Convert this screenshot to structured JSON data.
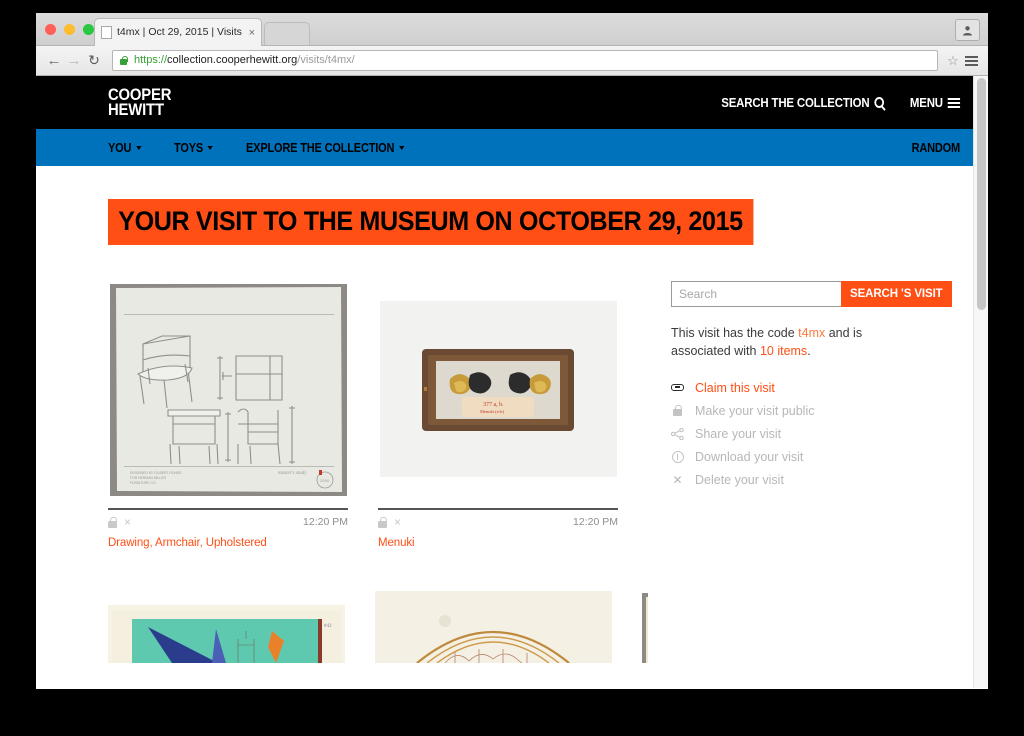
{
  "browser": {
    "tab_title": "t4mx | Oct 29, 2015 | Visits",
    "tab_close": "×",
    "url_scheme": "https://",
    "url_host": "collection.cooperhewitt.org",
    "url_path": "/visits/t4mx/",
    "back": "←",
    "forward": "→",
    "reload": "↻",
    "star": "☆"
  },
  "header": {
    "logo_line1": "COOPER",
    "logo_line2": "HEWITT",
    "search_collection": "SEARCH THE COLLECTION",
    "menu": "MENU"
  },
  "nav": {
    "items": [
      {
        "label": "YOU",
        "caret": true
      },
      {
        "label": "TOYS",
        "caret": true
      },
      {
        "label": "EXPLORE THE COLLECTION",
        "caret": true
      }
    ],
    "random": "RANDOM"
  },
  "main": {
    "page_title": "YOUR VISIT TO THE MUSEUM ON OCTOBER 29, 2015",
    "items": [
      {
        "caption": "Drawing, Armchair, Upholstered",
        "time": "12:20 PM",
        "lock": "lock-icon",
        "remove": "×"
      },
      {
        "caption": "Menuki",
        "time": "12:20 PM",
        "lock": "lock-icon",
        "remove": "×"
      }
    ]
  },
  "sidebar": {
    "search_placeholder": "Search",
    "search_value": "",
    "search_button": "SEARCH 'S VISIT",
    "info_pre": "This visit has the code ",
    "info_code": "t4mx",
    "info_mid": " and is associated with ",
    "info_count": "10 items",
    "info_post": ".",
    "actions": [
      {
        "label": "Claim this visit",
        "icon": "link-icon",
        "state": "active"
      },
      {
        "label": "Make your visit public",
        "icon": "lock-icon",
        "state": "disabled"
      },
      {
        "label": "Share your visit",
        "icon": "share-icon",
        "state": "disabled"
      },
      {
        "label": "Download your visit",
        "icon": "download-icon",
        "state": "disabled"
      },
      {
        "label": "Delete your visit",
        "icon": "close-icon",
        "state": "disabled"
      }
    ]
  },
  "colors": {
    "accent_orange": "#ff4f15",
    "nav_blue": "#0072bc",
    "header_black": "#000000",
    "link_orange": "#ff7a3d"
  }
}
